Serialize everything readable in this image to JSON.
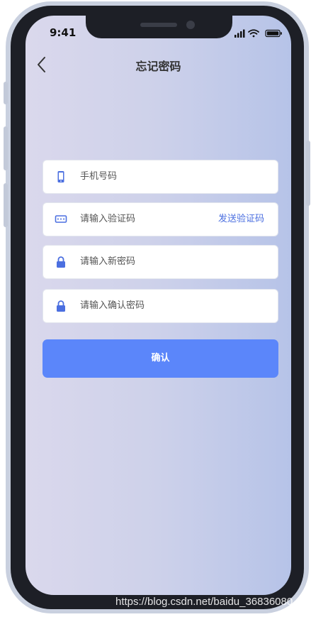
{
  "status_bar": {
    "time": "9:41",
    "icons": [
      "signal-icon",
      "wifi-icon",
      "battery-icon"
    ]
  },
  "header": {
    "back_icon": "chevron-left-icon",
    "title": "忘记密码"
  },
  "form": {
    "phone": {
      "icon": "mobile-phone-icon",
      "placeholder": "手机号码"
    },
    "code": {
      "icon": "sms-code-icon",
      "placeholder": "请输入验证码",
      "send_label": "发送验证码"
    },
    "new_password": {
      "icon": "lock-icon",
      "placeholder": "请输入新密码"
    },
    "confirm_password": {
      "icon": "lock-icon",
      "placeholder": "请输入确认密码"
    },
    "submit_label": "确认"
  },
  "colors": {
    "accent": "#5b86fa",
    "link": "#4b6fe0",
    "icon": "#4b6fe0",
    "background_start": "#dad8ec",
    "background_end": "#b6c3e8"
  },
  "watermark": "https://blog.csdn.net/baidu_36836080"
}
